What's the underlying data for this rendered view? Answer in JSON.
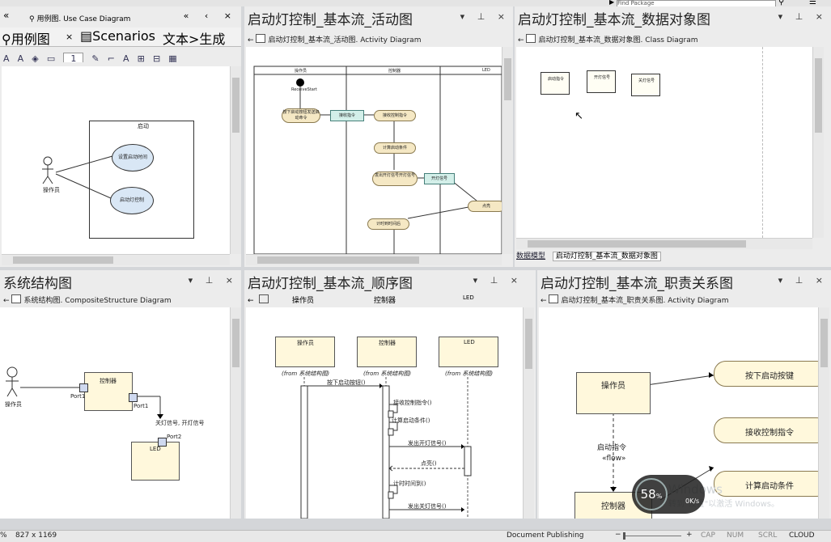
{
  "top": {
    "find_package": "Find Package"
  },
  "pane_usecase": {
    "collapse": "«",
    "header": "用例图.",
    "header_kind": "Use Case Diagram",
    "tab1": "用例图",
    "tab1_close": "×",
    "tab2": "Scenarios",
    "tab3": "文本>生成",
    "toolbar_value": "1",
    "system_label": "启动",
    "actor_label": "操作员",
    "uc1": "设置启动时间",
    "uc2": "启动灯控制"
  },
  "pane_activity": {
    "title": "启动灯控制_基本流_活动图",
    "sub": "启动灯控制_基本流_活动图.",
    "sub_kind": "Activity Diagram",
    "lanes": [
      "操作员",
      "控制器",
      "LED"
    ],
    "initial": "ReceiveStart",
    "nodes": [
      "按下启动按钮发送启动命令",
      "接收指令",
      "接收控制指令",
      "计算启动条件",
      "发出开灯信号开灯信号",
      "开灯信号",
      "点亮",
      "计时到时间后"
    ]
  },
  "pane_class": {
    "title": "启动灯控制_基本流_数据对象图",
    "sub": "启动灯控制_基本流_数据对象图.",
    "sub_kind": "Class Diagram",
    "boxes": [
      "启动指令",
      "开灯信号",
      "关灯信号"
    ],
    "tab1": "数据模型",
    "tab2": "启动灯控制_基本流_数据对象图"
  },
  "pane_composite": {
    "title": "系统结构图",
    "sub": "系统结构图.",
    "sub_kind": "CompositeStructure Diagram",
    "actor_label": "操作员",
    "controller": "控制器",
    "port1a": "Port1",
    "port1b": "Port1",
    "port2": "Port2",
    "led": "LED",
    "signal": "关灯信号, 开灯信号"
  },
  "pane_sequence": {
    "title": "启动灯控制_基本流_顺序图",
    "header_cols": [
      "操作员",
      "控制器",
      "LED"
    ],
    "lifelines": [
      "操作员",
      "控制器",
      "LED"
    ],
    "from_labels": [
      "(from 系统结构图)",
      "(from 系统结构图)",
      "(from 系统结构图)"
    ],
    "messages": [
      "按下启动按钮()",
      "接收控制指令()",
      "计算启动条件()",
      "发出开灯信号()",
      "点亮()",
      "计时时间到()",
      "发出关灯信号()"
    ]
  },
  "pane_responsibility": {
    "title": "启动灯控制_基本流_职责关系图",
    "sub": "启动灯控制_基本流_职责关系图.",
    "sub_kind": "Activity Diagram",
    "actor": "操作员",
    "controller": "控制器",
    "flow_label": "启动指令",
    "flow_stereo": "«flow»",
    "actions": [
      "按下启动按键",
      "接收控制指令",
      "计算启动条件"
    ]
  },
  "overlay": {
    "percent": "58",
    "percent_unit": "%",
    "windows_text": "Windows",
    "windows_sub": "转到\"设置\"以激活 Windows。",
    "speed": "0K/s"
  },
  "status": {
    "zoom_pct": "%",
    "page_size": "827 x 1169",
    "doc_publishing": "Document Publishing",
    "cap": "CAP",
    "num": "NUM",
    "scrl": "SCRL",
    "cloud": "CLOUD"
  }
}
